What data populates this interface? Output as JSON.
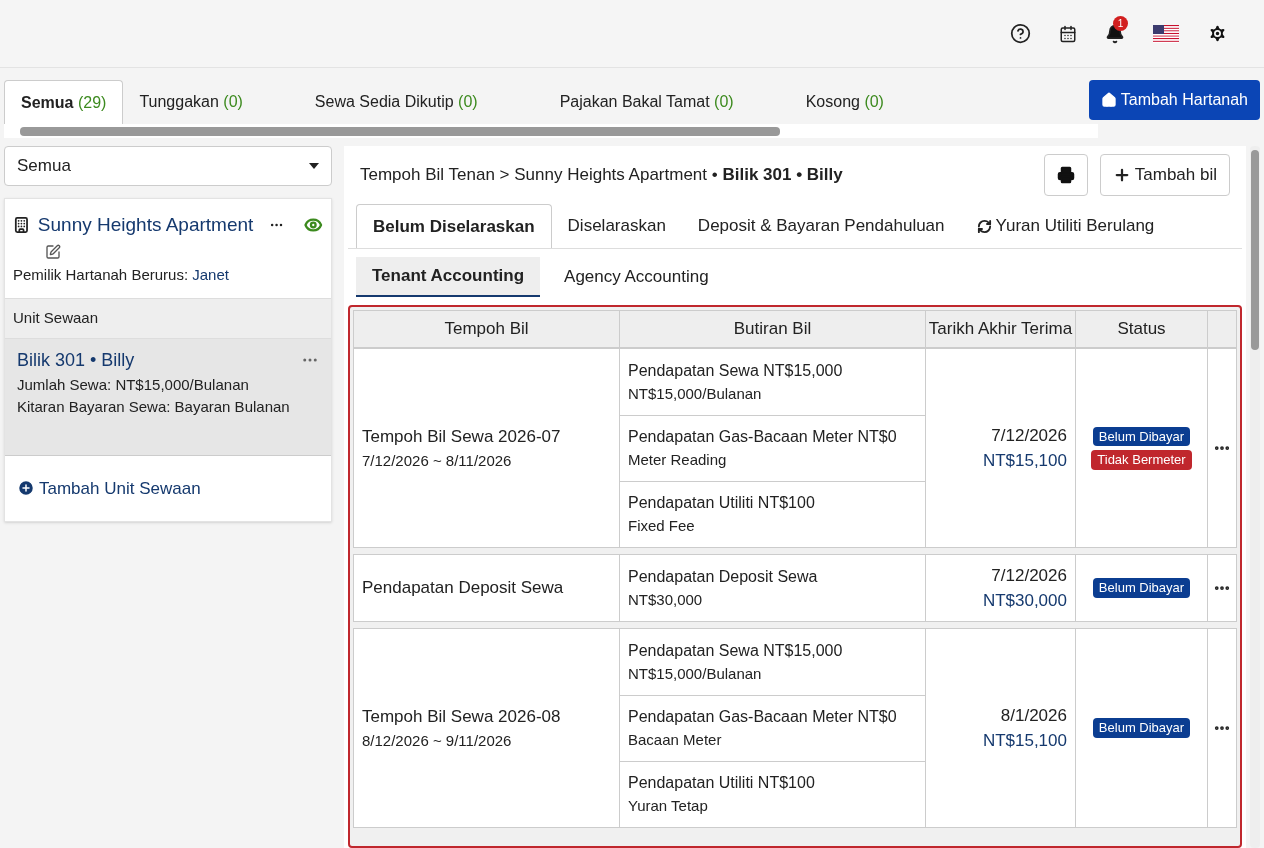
{
  "header": {
    "notification_count": "1"
  },
  "tabs": [
    {
      "label": "Semua",
      "count": "(29)",
      "selected": true
    },
    {
      "label": "Tunggakan",
      "count": "(0)",
      "selected": false
    },
    {
      "label": "Sewa Sedia Dikutip",
      "count": "(0)",
      "selected": false
    },
    {
      "label": "Pajakan Bakal Tamat",
      "count": "(0)",
      "selected": false
    },
    {
      "label": "Kosong",
      "count": "(0)",
      "selected": false
    }
  ],
  "add_property_button": "Tambah Hartanah",
  "sidebar": {
    "filter": {
      "value": "Semua"
    },
    "property": {
      "name": "Sunny Heights Apartment",
      "owner_label": "Pemilik Hartanah Berurus:",
      "owner": "Janet"
    },
    "units_heading": "Unit Sewaan",
    "units": [
      {
        "name": "Bilik 301 • Billy",
        "rent": "Jumlah Sewa: NT$15,000/Bulanan",
        "cycle": "Kitaran Bayaran Sewa: Bayaran Bulanan",
        "selected": true
      }
    ],
    "add_unit": "Tambah Unit Sewaan"
  },
  "main": {
    "breadcrumb": {
      "root": "Tempoh Bil Tenan",
      "separator": ">",
      "current": "Sunny Heights Apartment • **Bilik 301 • Billy**"
    },
    "add_bill_button": "Tambah bil",
    "tabs": [
      {
        "label": "Belum Diselaraskan",
        "selected": true,
        "kind": "text"
      },
      {
        "label": "Diselaraskan",
        "selected": false,
        "kind": "text"
      },
      {
        "label": "Deposit & Bayaran Pendahuluan",
        "selected": false,
        "kind": "text"
      },
      {
        "label": "Yuran Utiliti Berulang",
        "selected": false,
        "kind": "recurring"
      }
    ],
    "subtabs": [
      {
        "label": "Tenant Accounting",
        "selected": true
      },
      {
        "label": "Agency Accounting",
        "selected": false
      }
    ],
    "table": {
      "columns": [
        "Tempoh Bil",
        "Butiran Bil",
        "Tarikh Akhir Terima",
        "Status"
      ],
      "rows": [
        {
          "period": "Tempoh Bil Sewa 2026-07",
          "range": "7/12/2026 ~ 8/11/2026",
          "items": [
            {
              "title": "Pendapatan Sewa NT$15,000",
              "detail": "NT$15,000/Bulanan"
            },
            {
              "title": "Pendapatan Gas-Bacaan Meter NT$0",
              "detail": "Meter Reading"
            },
            {
              "title": "Pendapatan Utiliti NT$100",
              "detail": "Fixed Fee"
            }
          ],
          "due": "7/12/2026",
          "amount": "NT$15,100",
          "statuses": [
            {
              "label": "Belum Dibayar",
              "kind": "unpaid"
            },
            {
              "label": "Tidak Bermeter",
              "kind": "unmetered"
            }
          ]
        },
        {
          "period": "Pendapatan Deposit Sewa",
          "items": [
            {
              "title": "Pendapatan Deposit Sewa",
              "detail": "NT$30,000"
            }
          ],
          "due": "7/12/2026",
          "amount": "NT$30,000",
          "statuses": [
            {
              "label": "Belum Dibayar",
              "kind": "unpaid"
            }
          ]
        },
        {
          "period": "Tempoh Bil Sewa 2026-08",
          "range": "8/12/2026 ~ 9/11/2026",
          "items": [
            {
              "title": "Pendapatan Sewa NT$15,000",
              "detail": "NT$15,000/Bulanan"
            },
            {
              "title": "Pendapatan Gas-Bacaan Meter NT$0",
              "detail": "Bacaan Meter"
            },
            {
              "title": "Pendapatan Utiliti NT$100",
              "detail": "Yuran Tetap"
            }
          ],
          "due": "8/1/2026",
          "amount": "NT$15,100",
          "statuses": [
            {
              "label": "Belum Dibayar",
              "kind": "unpaid"
            }
          ]
        }
      ]
    }
  }
}
